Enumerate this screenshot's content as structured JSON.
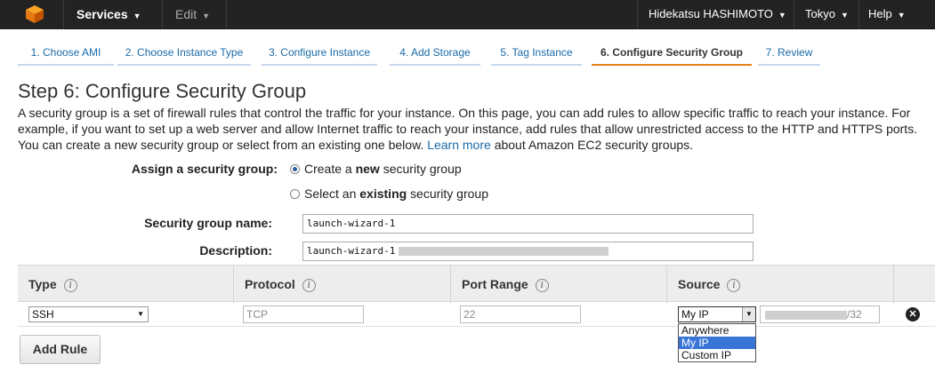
{
  "topnav": {
    "services": "Services",
    "edit": "Edit",
    "user": "Hidekatsu HASHIMOTO",
    "region": "Tokyo",
    "help": "Help"
  },
  "tabs": [
    {
      "label": "1. Choose AMI"
    },
    {
      "label": "2. Choose Instance Type"
    },
    {
      "label": "3. Configure Instance"
    },
    {
      "label": "4. Add Storage"
    },
    {
      "label": "5. Tag Instance"
    },
    {
      "label": "6. Configure Security Group",
      "active": true
    },
    {
      "label": "7. Review"
    }
  ],
  "page": {
    "title": "Step 6: Configure Security Group",
    "description": "A security group is a set of firewall rules that control the traffic for your instance. On this page, you can add rules to allow specific traffic to reach your instance. For example, if you want to set up a web server and allow Internet traffic to reach your instance, add rules that allow unrestricted access to the HTTP and HTTPS ports. You can create a new security group or select from an existing one below.",
    "learn_more": "Learn more",
    "desc_tail": "about Amazon EC2 security groups."
  },
  "form": {
    "assign_label": "Assign a security group:",
    "option_create_pre": "Create a ",
    "option_create_bold": "new",
    "option_create_post": " security group",
    "option_select_pre": "Select an ",
    "option_select_bold": "existing",
    "option_select_post": " security group",
    "name_label": "Security group name:",
    "name_value": "launch-wizard-1",
    "description_label": "Description:",
    "description_value": "launch-wizard-1"
  },
  "table": {
    "headers": [
      "Type",
      "Protocol",
      "Port Range",
      "Source"
    ],
    "row": {
      "type": "SSH",
      "protocol": "TCP",
      "port_range": "22",
      "source": "My IP",
      "cidr_suffix": "/32"
    },
    "source_options": [
      "Anywhere",
      "My IP",
      "Custom IP"
    ],
    "selected_source_option": "My IP"
  },
  "actions": {
    "add_rule": "Add Rule"
  }
}
